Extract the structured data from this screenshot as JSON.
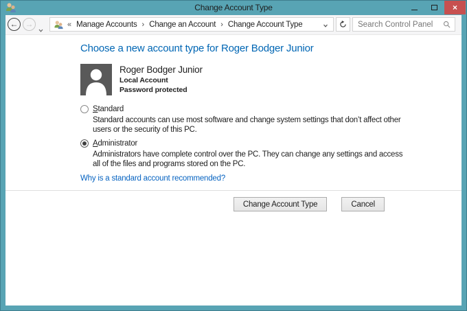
{
  "colors": {
    "frame_teal": "#58A4B4",
    "close_red": "#C75050",
    "heading_blue": "#0066B4",
    "link_blue": "#0663C1"
  },
  "window": {
    "title": "Change Account Type"
  },
  "icons": {
    "back": "←",
    "forward": "→",
    "up": "↑",
    "close": "×",
    "breadcrumb_prefix": "«",
    "breadcrumb_separator": "›"
  },
  "navbar": {
    "breadcrumb": {
      "items": [
        "Manage Accounts",
        "Change an Account",
        "Change Account Type"
      ]
    },
    "search": {
      "placeholder": "Search Control Panel",
      "value": ""
    }
  },
  "main": {
    "heading": "Choose a new account type for Roger Bodger Junior",
    "account": {
      "name": "Roger Bodger Junior",
      "type": "Local Account",
      "protection": "Password protected"
    },
    "options": [
      {
        "label": "Standard",
        "selected": false,
        "description": "Standard accounts can use most software and change system settings that don’t affect other users or the security of this PC."
      },
      {
        "label": "Administrator",
        "selected": true,
        "description": "Administrators have complete control over the PC. They can change any settings and access all of the files and programs stored on the PC."
      }
    ],
    "link": "Why is a standard account recommended?",
    "buttons": {
      "primary": "Change Account Type",
      "cancel": "Cancel"
    }
  }
}
